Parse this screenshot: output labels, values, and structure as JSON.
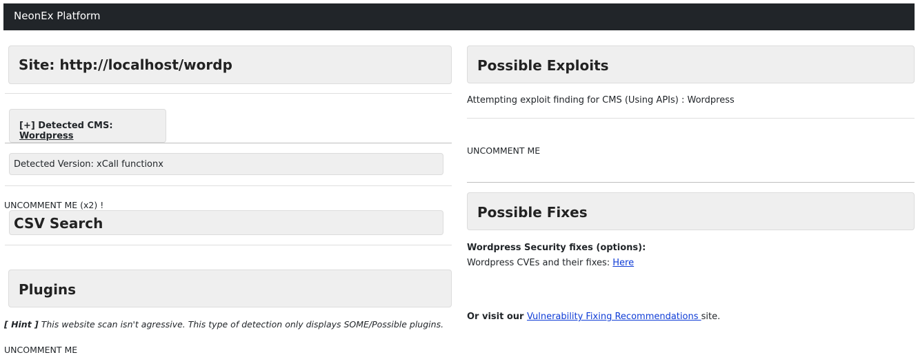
{
  "navbar": {
    "brand": "NeonEx Platform"
  },
  "left": {
    "site_heading": "Site: http://localhost/wordp",
    "cms_prefix": "[+] Detected CMS: ",
    "cms_name": "Wordpress",
    "version_text": "Detected Version: xCall functionx",
    "uncomment_x2": "UNCOMMENT ME (x2) !",
    "csv_heading": "CSV Search",
    "plugins_heading": "Plugins",
    "hint_label": "[ Hint ]",
    "hint_text": " This website scan isn't agressive. This type of detection only displays SOME/Possible plugins.",
    "uncomment_bottom": "UNCOMMENT ME"
  },
  "right": {
    "exploits_heading": "Possible Exploits",
    "exploit_text": "Attempting exploit finding for CMS (Using APIs) : Wordpress",
    "uncomment": "UNCOMMENT ME",
    "fixes_heading": "Possible Fixes",
    "fixes_title": "Wordpress Security fixes (options):",
    "cves_text": "Wordpress CVEs and their fixes: ",
    "cves_link": "Here",
    "visit_prefix": "Or visit our ",
    "visit_link": "Vulnerability Fixing Recommendations ",
    "visit_suffix": "site."
  }
}
